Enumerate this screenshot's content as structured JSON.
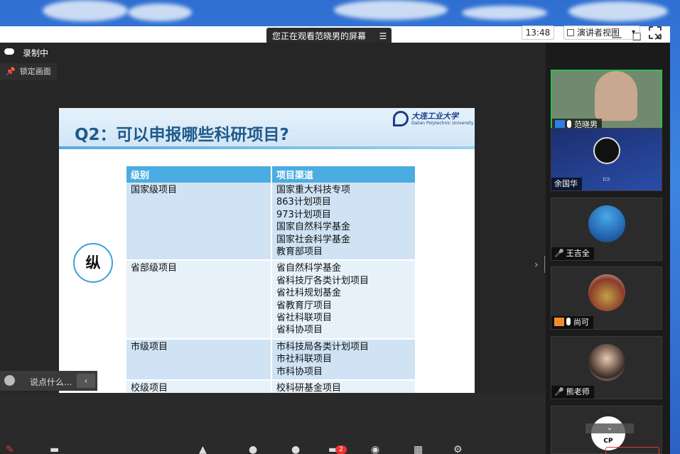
{
  "meeting": {
    "sharing_banner": "您正在观看范晓男的屏幕",
    "time": "13:48",
    "view_label": "演讲者视图",
    "recording": "录制中",
    "lock_label": "锁定画面",
    "chat_placeholder": "说点什么..."
  },
  "slide": {
    "title": "Q2：可以申报哪些科研项目?",
    "logo_cn": "大连工业大学",
    "logo_en": "Dalian Polytechnic University",
    "badge": "纵",
    "table": {
      "headers": [
        "级别",
        "项目渠道"
      ],
      "rows": [
        {
          "level": "国家级项目",
          "items": [
            "国家重大科技专项",
            "863计划项目",
            "973计划项目",
            "国家自然科学基金",
            "国家社会科学基金",
            "教育部项目"
          ]
        },
        {
          "level": "省部级项目",
          "items": [
            "省自然科学基金",
            "省科技厅各类计划项目",
            "省社科规划基金",
            "省教育厅项目",
            "省社科联项目",
            "省科协项目"
          ]
        },
        {
          "level": "市级项目",
          "items": [
            "市科技局各类计划项目",
            "市社科联项目",
            "市科协项目"
          ]
        },
        {
          "level": "校级项目",
          "items": [
            "校科研基金项目"
          ]
        }
      ]
    }
  },
  "participants": [
    {
      "name": "范晓男"
    },
    {
      "name": "余国华"
    },
    {
      "name": "王吉全"
    },
    {
      "name": "尚可"
    },
    {
      "name": "熊老师"
    },
    {
      "name": "CP"
    }
  ],
  "badges": {
    "chat_count": "2"
  }
}
